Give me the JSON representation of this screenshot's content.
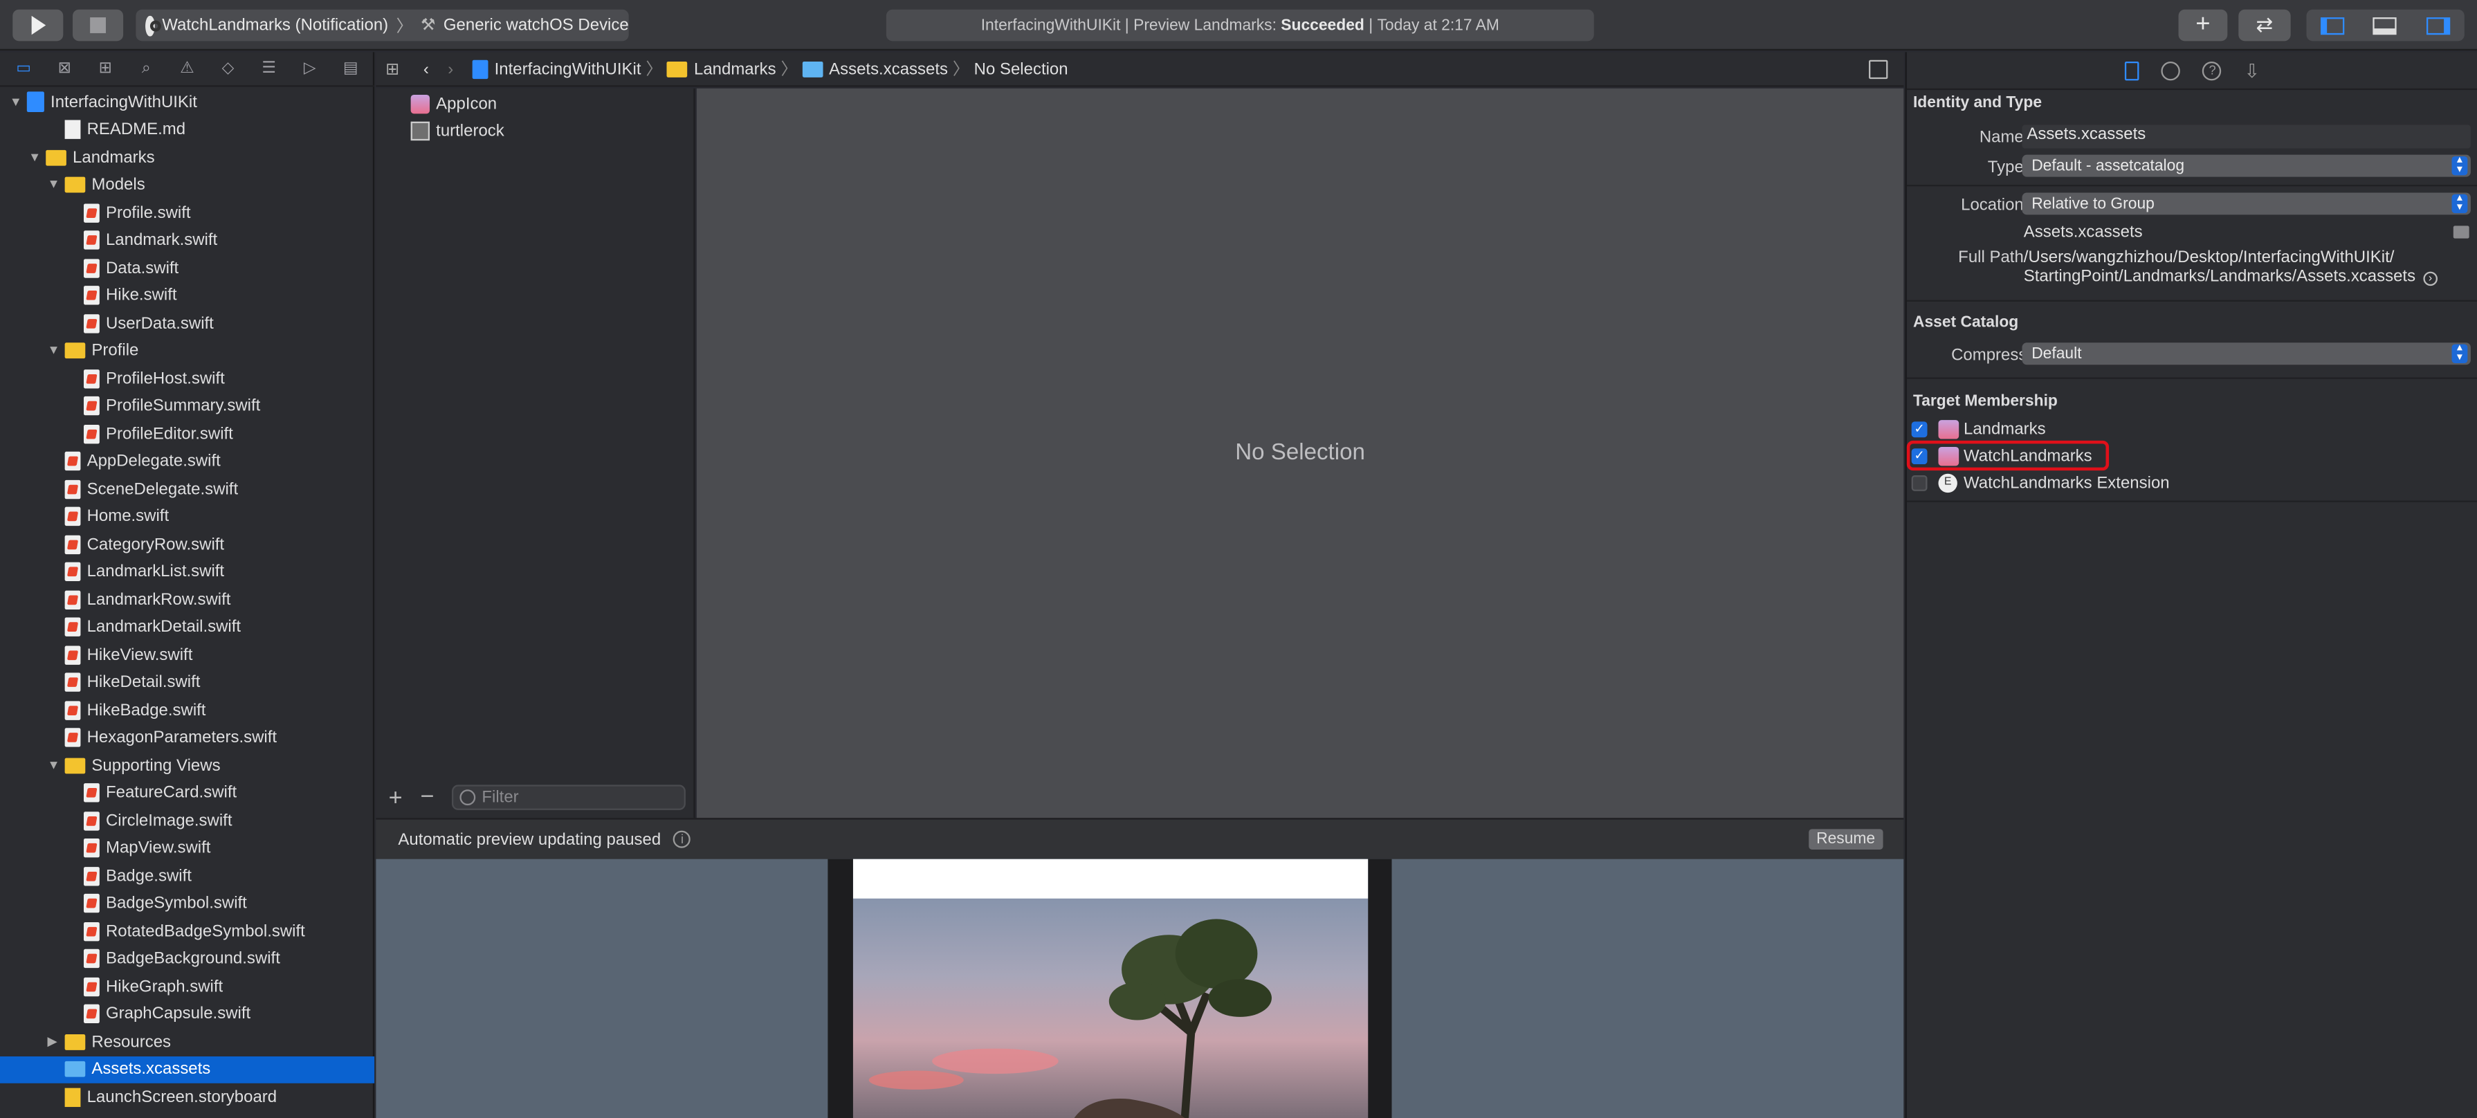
{
  "toolbar": {
    "scheme_target": "WatchLandmarks (Notification)",
    "scheme_device": "Generic watchOS Device",
    "status_project": "InterfacingWithUIKit",
    "status_action": "Preview Landmarks:",
    "status_result": "Succeeded",
    "status_time": "Today at 2:17 AM"
  },
  "navigator": {
    "items": [
      {
        "label": "InterfacingWithUIKit",
        "kind": "project",
        "level": 0,
        "expanded": true
      },
      {
        "label": "README.md",
        "kind": "file",
        "level": 2
      },
      {
        "label": "Landmarks",
        "kind": "folder",
        "level": 1,
        "expanded": true
      },
      {
        "label": "Models",
        "kind": "folder",
        "level": 2,
        "expanded": true
      },
      {
        "label": "Profile.swift",
        "kind": "swift",
        "level": 3
      },
      {
        "label": "Landmark.swift",
        "kind": "swift",
        "level": 3
      },
      {
        "label": "Data.swift",
        "kind": "swift",
        "level": 3
      },
      {
        "label": "Hike.swift",
        "kind": "swift",
        "level": 3
      },
      {
        "label": "UserData.swift",
        "kind": "swift",
        "level": 3
      },
      {
        "label": "Profile",
        "kind": "folder",
        "level": 2,
        "expanded": true
      },
      {
        "label": "ProfileHost.swift",
        "kind": "swift",
        "level": 3
      },
      {
        "label": "ProfileSummary.swift",
        "kind": "swift",
        "level": 3
      },
      {
        "label": "ProfileEditor.swift",
        "kind": "swift",
        "level": 3
      },
      {
        "label": "AppDelegate.swift",
        "kind": "swift",
        "level": 2
      },
      {
        "label": "SceneDelegate.swift",
        "kind": "swift",
        "level": 2
      },
      {
        "label": "Home.swift",
        "kind": "swift",
        "level": 2
      },
      {
        "label": "CategoryRow.swift",
        "kind": "swift",
        "level": 2
      },
      {
        "label": "LandmarkList.swift",
        "kind": "swift",
        "level": 2
      },
      {
        "label": "LandmarkRow.swift",
        "kind": "swift",
        "level": 2
      },
      {
        "label": "LandmarkDetail.swift",
        "kind": "swift",
        "level": 2
      },
      {
        "label": "HikeView.swift",
        "kind": "swift",
        "level": 2
      },
      {
        "label": "HikeDetail.swift",
        "kind": "swift",
        "level": 2
      },
      {
        "label": "HikeBadge.swift",
        "kind": "swift",
        "level": 2
      },
      {
        "label": "HexagonParameters.swift",
        "kind": "swift",
        "level": 2
      },
      {
        "label": "Supporting Views",
        "kind": "folder",
        "level": 2,
        "expanded": true
      },
      {
        "label": "FeatureCard.swift",
        "kind": "swift",
        "level": 3
      },
      {
        "label": "CircleImage.swift",
        "kind": "swift",
        "level": 3
      },
      {
        "label": "MapView.swift",
        "kind": "swift",
        "level": 3
      },
      {
        "label": "Badge.swift",
        "kind": "swift",
        "level": 3
      },
      {
        "label": "BadgeSymbol.swift",
        "kind": "swift",
        "level": 3
      },
      {
        "label": "RotatedBadgeSymbol.swift",
        "kind": "swift",
        "level": 3
      },
      {
        "label": "BadgeBackground.swift",
        "kind": "swift",
        "level": 3
      },
      {
        "label": "HikeGraph.swift",
        "kind": "swift",
        "level": 3
      },
      {
        "label": "GraphCapsule.swift",
        "kind": "swift",
        "level": 3
      },
      {
        "label": "Resources",
        "kind": "folder",
        "level": 2,
        "expanded": false
      },
      {
        "label": "Assets.xcassets",
        "kind": "assets",
        "level": 2,
        "selected": true
      },
      {
        "label": "LaunchScreen.storyboard",
        "kind": "storyboard",
        "level": 2
      }
    ]
  },
  "jumpbar": {
    "crumbs": [
      "InterfacingWithUIKit",
      "Landmarks",
      "Assets.xcassets",
      "No Selection"
    ]
  },
  "assets": {
    "items": [
      "AppIcon",
      "turtlerock"
    ],
    "filter_placeholder": "Filter"
  },
  "editor": {
    "empty_text": "No Selection"
  },
  "canvas": {
    "status_text": "Automatic preview updating paused",
    "resume_label": "Resume"
  },
  "inspector": {
    "identity_title": "Identity and Type",
    "name_label": "Name",
    "name_value": "Assets.xcassets",
    "type_label": "Type",
    "type_value": "Default - assetcatalog",
    "location_label": "Location",
    "location_value": "Relative to Group",
    "location_file": "Assets.xcassets",
    "fullpath_label": "Full Path",
    "fullpath_line1": "/Users/wangzhizhou/Desktop/InterfacingWithUIKit/",
    "fullpath_line2": "StartingPoint/Landmarks/Landmarks/Assets.xcassets",
    "catalog_title": "Asset Catalog",
    "compression_label": "Compression",
    "compression_value": "Default",
    "membership_title": "Target Membership",
    "targets": [
      {
        "label": "Landmarks",
        "checked": true
      },
      {
        "label": "WatchLandmarks",
        "checked": true,
        "highlighted": true
      },
      {
        "label": "WatchLandmarks Extension",
        "checked": false
      }
    ]
  },
  "colors": {
    "accent": "#0a62d0",
    "highlight": "#e0101a",
    "folder": "#f3c32e"
  }
}
